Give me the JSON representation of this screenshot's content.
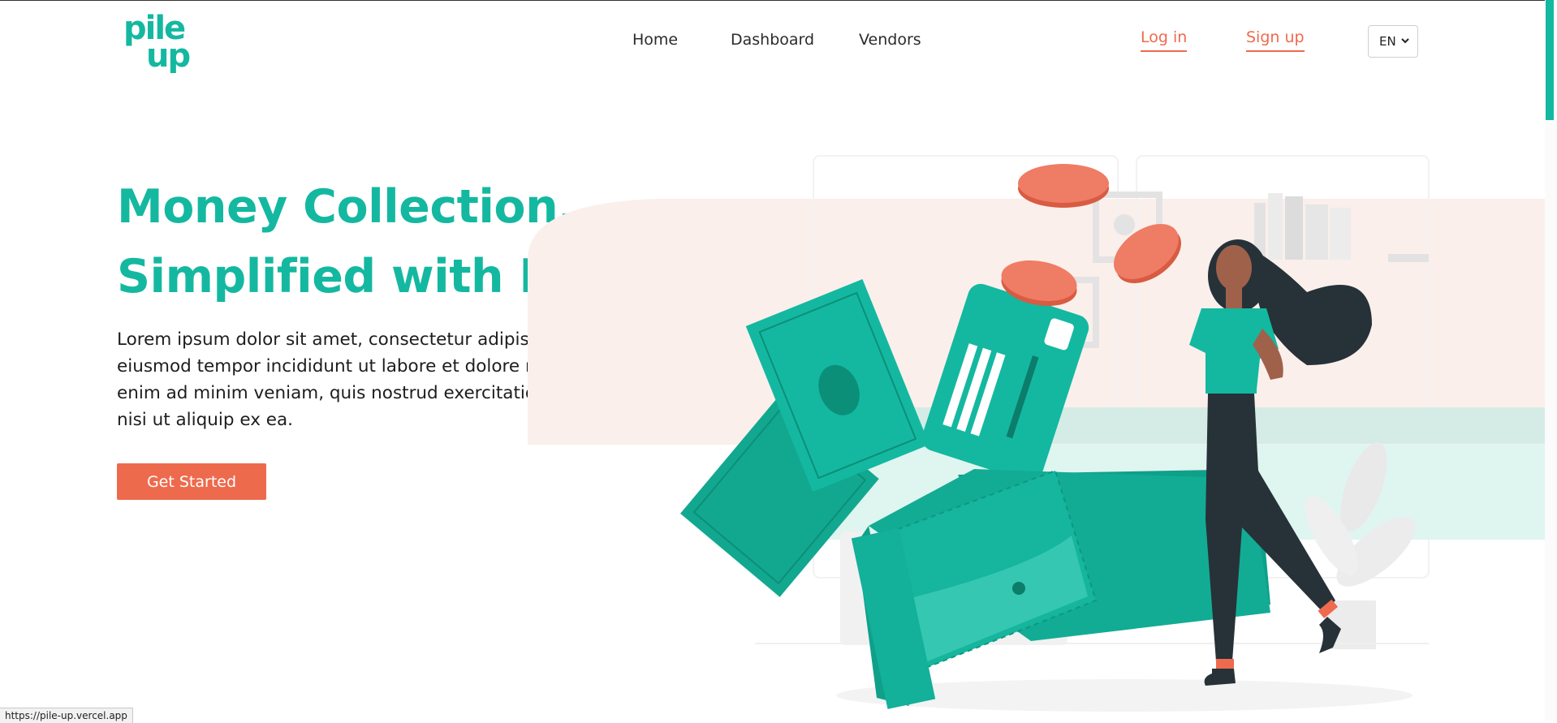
{
  "brand": {
    "logo_top": "pile",
    "logo_bottom": "up",
    "color": "#14b8a0"
  },
  "nav": {
    "links": [
      {
        "label": "Home"
      },
      {
        "label": "Dashboard"
      },
      {
        "label": "Vendors"
      }
    ],
    "login": "Log in",
    "signup": "Sign up",
    "language": {
      "selected": "EN",
      "icon": "chevron-down-icon"
    }
  },
  "hero": {
    "title_line1": "Money Collection,",
    "title_line2": "Simplified with PileUp!",
    "description": "Lorem ipsum dolor sit amet, consectetur adipiscing elit, sed do eiusmod tempor incididunt ut labore et dolore magna aliqua. Ut enim ad minim veniam, quis nostrud exercitation ullamco laboris nisi ut aliquip ex ea.",
    "cta": "Get Started"
  },
  "status_bar": {
    "url": "https://pile-up.vercel.app"
  },
  "colors": {
    "accent": "#14b8a0",
    "coral": "#ef6a4e",
    "blush": "#fbefeb",
    "mint": "#d7f3ee"
  }
}
